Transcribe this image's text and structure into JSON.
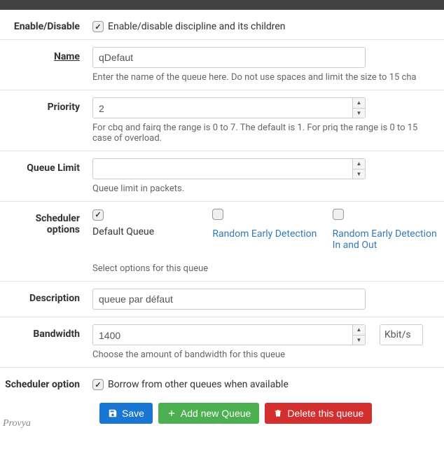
{
  "fields": {
    "enable": {
      "label": "Enable/Disable",
      "text": "Enable/disable discipline and its children",
      "checked": true
    },
    "name": {
      "label": "Name",
      "value": "qDefaut",
      "help": "Enter the name of the queue here. Do not use spaces and limit the size to 15 cha"
    },
    "priority": {
      "label": "Priority",
      "value": "2",
      "help": "For cbq and fairq the range is 0 to 7. The default is 1. For priq the range is 0 to 15 case of overload."
    },
    "qlimit": {
      "label": "Queue Limit",
      "value": "",
      "help": "Queue limit in packets."
    },
    "sched_opts": {
      "label": "Scheduler options",
      "help": "Select options for this queue",
      "options": [
        {
          "label": "Default Queue",
          "checked": true,
          "link": false
        },
        {
          "label": "Random Early Detection",
          "checked": false,
          "link": true
        },
        {
          "label": "Random Early Detection In and Out",
          "checked": false,
          "link": true
        }
      ]
    },
    "desc": {
      "label": "Description",
      "value": "queue par défaut"
    },
    "bandwidth": {
      "label": "Bandwidth",
      "value": "1400",
      "unit": "Kbit/s",
      "help": "Choose the amount of bandwidth for this queue"
    },
    "sched_opt2": {
      "label": "Scheduler option",
      "text": "Borrow from other queues when available",
      "checked": true
    }
  },
  "buttons": {
    "save": "Save",
    "add": "Add new Queue",
    "delete": "Delete this queue"
  },
  "watermark": "Provya"
}
